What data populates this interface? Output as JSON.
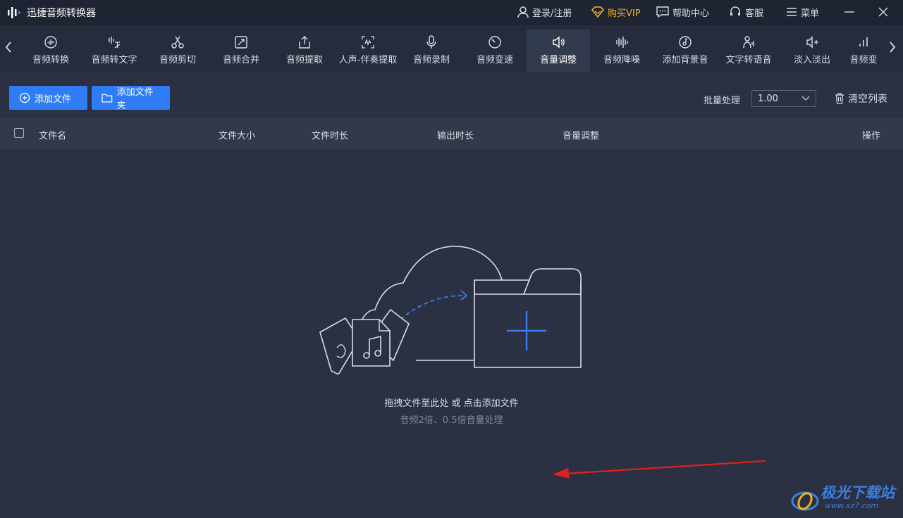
{
  "app": {
    "title": "迅捷音频转换器"
  },
  "titlebar": {
    "login": "登录/注册",
    "vip": "购买VIP",
    "help": "帮助中心",
    "service": "客服",
    "menu": "菜单"
  },
  "tools": [
    {
      "label": "音频转换",
      "icon": "audio-convert-icon"
    },
    {
      "label": "音频转文字",
      "icon": "audio-to-text-icon"
    },
    {
      "label": "音频剪切",
      "icon": "scissors-icon"
    },
    {
      "label": "音频合并",
      "icon": "merge-icon"
    },
    {
      "label": "音频提取",
      "icon": "extract-icon"
    },
    {
      "label": "人声-伴奏提取",
      "icon": "vocal-extract-icon"
    },
    {
      "label": "音频录制",
      "icon": "microphone-icon"
    },
    {
      "label": "音频变速",
      "icon": "speed-icon"
    },
    {
      "label": "音量调整",
      "icon": "volume-icon",
      "active": true
    },
    {
      "label": "音频降噪",
      "icon": "noise-reduction-icon"
    },
    {
      "label": "添加背景音",
      "icon": "background-music-icon"
    },
    {
      "label": "文字转语音",
      "icon": "text-to-speech-icon"
    },
    {
      "label": "淡入淡出",
      "icon": "fade-icon"
    },
    {
      "label": "音频变",
      "icon": "more-icon"
    }
  ],
  "actions": {
    "add_file": "添加文件",
    "add_folder": "添加文件夹",
    "batch_label": "批量处理",
    "batch_value": "1.00",
    "clear_list": "清空列表"
  },
  "table": {
    "columns": [
      "文件名",
      "文件大小",
      "文件时长",
      "输出时长",
      "音量调整",
      "操作"
    ]
  },
  "dropzone": {
    "hint": "拖拽文件至此处 或 点击添加文件",
    "sub_hint": "音频2倍、0.5倍音量处理"
  },
  "watermark": {
    "title": "极光下载站",
    "url": "www.xz7.com"
  },
  "colors": {
    "accent": "#2f7cf6",
    "vip": "#f2b01e",
    "annotation_arrow": "#e02020"
  }
}
